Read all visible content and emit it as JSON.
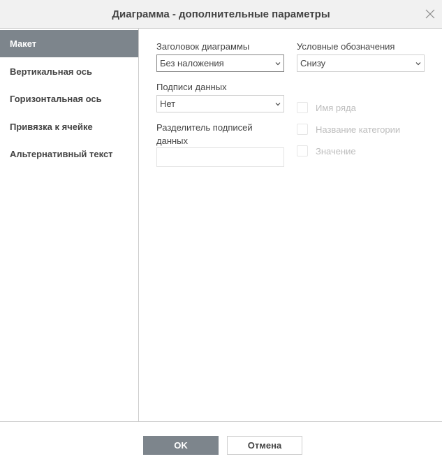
{
  "dialog": {
    "title": "Диаграмма - дополнительные параметры"
  },
  "sidebar": {
    "items": [
      {
        "label": "Макет",
        "active": true
      },
      {
        "label": "Вертикальная ось",
        "active": false
      },
      {
        "label": "Горизонтальная ось",
        "active": false
      },
      {
        "label": "Привязка к ячейке",
        "active": false
      },
      {
        "label": "Альтернативный текст",
        "active": false
      }
    ]
  },
  "layout": {
    "chart_title": {
      "label": "Заголовок диаграммы",
      "value": "Без наложения"
    },
    "legend": {
      "label": "Условные обозначения",
      "value": "Снизу"
    },
    "data_labels": {
      "label": "Подписи данных",
      "value": "Нет"
    },
    "separator": {
      "label_line1": "Разделитель подписей",
      "label_line2": "данных",
      "value": ""
    },
    "checkboxes": [
      {
        "label": "Имя ряда",
        "checked": false,
        "disabled": true
      },
      {
        "label": "Название категории",
        "checked": false,
        "disabled": true
      },
      {
        "label": "Значение",
        "checked": false,
        "disabled": true
      }
    ]
  },
  "footer": {
    "ok_label": "OK",
    "cancel_label": "Отмена"
  },
  "colors": {
    "accent": "#7d858c",
    "border": "#cbcbcb",
    "disabled_text": "#bdbdbd"
  },
  "icons": {
    "close": "close-icon",
    "dropdown": "chevron-down-icon"
  }
}
